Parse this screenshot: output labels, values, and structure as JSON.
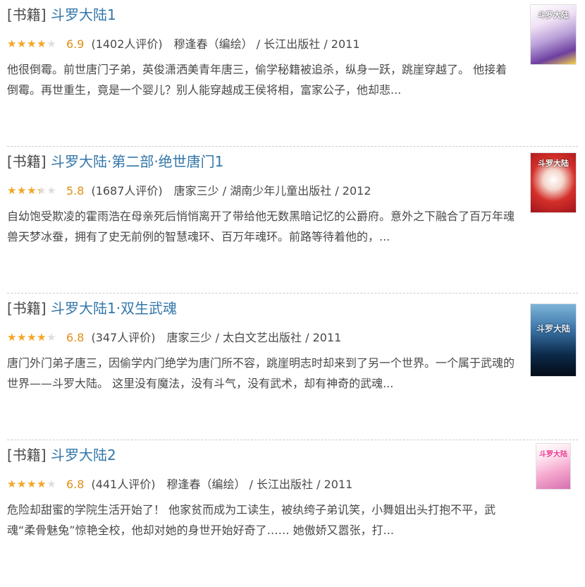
{
  "colors": {
    "link": "#3377aa",
    "text": "#494949",
    "star": "#f5a623",
    "star_empty": "#dddddd",
    "score": "#e09015"
  },
  "icons": {
    "star": "star-icon"
  },
  "results": [
    {
      "category": "[书籍]",
      "title": "斗罗大陆1",
      "rating": 6.9,
      "rating_text": "6.9",
      "stars": 3.5,
      "votes": "(1402人评价)",
      "pub": "穆逢春（编绘） / 长江出版社 / 2011",
      "abstract": "他很倒霉。前世唐门子弟，英俊潇洒美青年唐三，偷学秘籍被追杀，纵身一跃，跳崖穿越了。 他接着倒霉。再世重生，竟是一个婴儿？别人能穿越成王侯将相，富家公子，他却悲...",
      "cover_text": "斗罗大陆"
    },
    {
      "category": "[书籍]",
      "title": "斗罗大陆·第二部·绝世唐门1",
      "rating": 5.8,
      "rating_text": "5.8",
      "stars": 3,
      "votes": "(1687人评价)",
      "pub": "唐家三少 / 湖南少年儿童出版社 / 2012",
      "abstract": "自幼饱受欺凌的霍雨浩在母亲死后悄悄离开了带给他无数黑暗记忆的公爵府。意外之下融合了百万年魂兽天梦冰蚕，拥有了史无前例的智慧魂环、百万年魂环。前路等待着他的，...",
      "cover_text": "斗罗大陆"
    },
    {
      "category": "[书籍]",
      "title": "斗罗大陆1·双生武魂",
      "rating": 6.8,
      "rating_text": "6.8",
      "stars": 3.5,
      "votes": "(347人评价)",
      "pub": "唐家三少 / 太白文艺出版社 / 2011",
      "abstract": "唐门外门弟子唐三，因偷学内门绝学为唐门所不容，跳崖明志时却来到了另一个世界。一个属于武魂的世界——斗罗大陆。 这里没有魔法，没有斗气，没有武术，却有神奇的武魂...",
      "cover_text": "斗罗大陆"
    },
    {
      "category": "[书籍]",
      "title": "斗罗大陆2",
      "rating": 6.8,
      "rating_text": "6.8",
      "stars": 3.5,
      "votes": "(441人评价)",
      "pub": "穆逢春（编绘） / 长江出版社 / 2011",
      "abstract": "危险却甜蜜的学院生活开始了！ 他家贫而成为工读生，被纨绔子弟讥笑，小舞姐出头打抱不平，武魂“柔骨魅兔”惊艳全校，他却对她的身世开始好奇了…… 她傲娇又嚣张，打...",
      "cover_text": "斗罗大陆"
    }
  ]
}
